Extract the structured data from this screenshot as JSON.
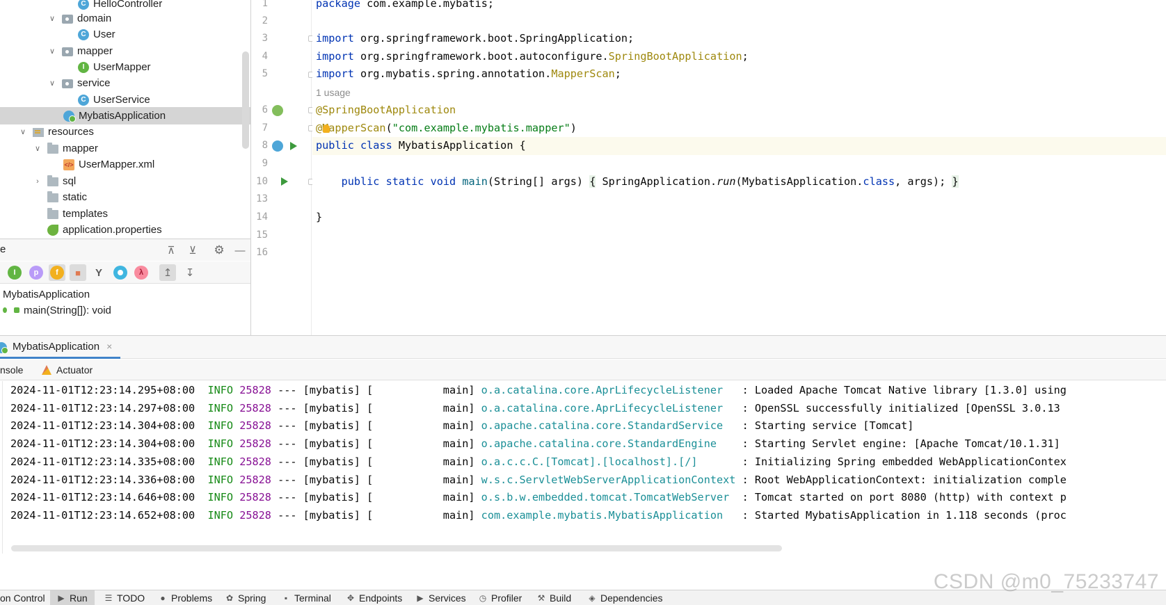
{
  "project_tree": {
    "items": [
      {
        "label": "HelloController",
        "icon": "class-icon"
      },
      {
        "label": "domain",
        "icon": "package-icon"
      },
      {
        "label": "User",
        "icon": "class-icon"
      },
      {
        "label": "mapper",
        "icon": "package-icon"
      },
      {
        "label": "UserMapper",
        "icon": "interface-icon"
      },
      {
        "label": "service",
        "icon": "package-icon"
      },
      {
        "label": "UserService",
        "icon": "class-icon"
      },
      {
        "label": "MybatisApplication",
        "icon": "spring-boot-app-icon",
        "selected": true
      },
      {
        "label": "resources",
        "icon": "resources-folder-icon"
      },
      {
        "label": "mapper",
        "icon": "folder-icon"
      },
      {
        "label": "UserMapper.xml",
        "icon": "xml-file-icon"
      },
      {
        "label": "sql",
        "icon": "folder-icon"
      },
      {
        "label": "static",
        "icon": "folder-icon"
      },
      {
        "label": "templates",
        "icon": "folder-icon"
      },
      {
        "label": "application.properties",
        "icon": "properties-file-icon"
      }
    ]
  },
  "structure": {
    "title_fragment": "e",
    "filter_icons": [
      "inherited-icon",
      "properties-p-icon",
      "fields-f-icon",
      "non-public-lock-icon",
      "hierarchy-icon",
      "anonymous-icon",
      "lambda-icon",
      "autoscroll-to-source-icon",
      "autoscroll-from-source-icon"
    ],
    "filter_letters": {
      "p": "p",
      "f": "f",
      "lambda": "λ",
      "inherited": "I"
    },
    "class_name": "MybatisApplication",
    "method": "main(String[]): void"
  },
  "editor": {
    "line_numbers": [
      "1",
      "2",
      "3",
      "4",
      "5",
      "6",
      "7",
      "8",
      "9",
      "10",
      "13",
      "14",
      "15",
      "16"
    ],
    "usage_hint": "1 usage",
    "lines": {
      "l1_kw": "package",
      "l1_rest": " com.example.mybatis;",
      "l3_kw": "import",
      "l3_rest": " org.springframework.boot.SpringApplication;",
      "l4_kw": "import",
      "l4_pkg": " org.springframework.boot.autoconfigure.",
      "l4_ann": "SpringBootApplication",
      "l4_end": ";",
      "l5_kw": "import",
      "l5_pkg": " org.mybatis.spring.annotation.",
      "l5_ann": "MapperScan",
      "l5_end": ";",
      "l6_ann": "@SpringBootApplication",
      "l7_ann": "@MapperScan",
      "l7_open": "(",
      "l7_str": "\"com.example.mybatis.mapper\"",
      "l7_close": ")",
      "l8_kw": "public class",
      "l8_rest": " MybatisApplication {",
      "l10_indent": "    ",
      "l10_kw": "public static void",
      "l10_sp": " ",
      "l10_fn": "main",
      "l10_args": "(String[] args) ",
      "l10_ob": "{",
      "l10_call": " SpringApplication.",
      "l10_run": "run",
      "l10_cls": "(MybatisApplication.",
      "l10_classkw": "class",
      "l10_tail": ", args); ",
      "l10_cb": "}",
      "l14": "}"
    }
  },
  "run_panel": {
    "tab_label": "MybatisApplication",
    "close_glyph": "×",
    "console_tab": "nsole",
    "actuator_tab": "Actuator",
    "logs": [
      {
        "ts": "2024-11-01T12:23:14.295+08:00",
        "lvl": "INFO",
        "pid": "25828",
        "sep": " --- [mybatis] [           main] ",
        "logger": "o.a.catalina.core.AprLifecycleListener  ",
        "msg": " : Loaded Apache Tomcat Native library [1.3.0] using"
      },
      {
        "ts": "2024-11-01T12:23:14.297+08:00",
        "lvl": "INFO",
        "pid": "25828",
        "sep": " --- [mybatis] [           main] ",
        "logger": "o.a.catalina.core.AprLifecycleListener  ",
        "msg": " : OpenSSL successfully initialized [OpenSSL 3.0.13"
      },
      {
        "ts": "2024-11-01T12:23:14.304+08:00",
        "lvl": "INFO",
        "pid": "25828",
        "sep": " --- [mybatis] [           main] ",
        "logger": "o.apache.catalina.core.StandardService  ",
        "msg": " : Starting service [Tomcat]"
      },
      {
        "ts": "2024-11-01T12:23:14.304+08:00",
        "lvl": "INFO",
        "pid": "25828",
        "sep": " --- [mybatis] [           main] ",
        "logger": "o.apache.catalina.core.StandardEngine   ",
        "msg": " : Starting Servlet engine: [Apache Tomcat/10.1.31]"
      },
      {
        "ts": "2024-11-01T12:23:14.335+08:00",
        "lvl": "INFO",
        "pid": "25828",
        "sep": " --- [mybatis] [           main] ",
        "logger": "o.a.c.c.C.[Tomcat].[localhost].[/]      ",
        "msg": " : Initializing Spring embedded WebApplicationContex"
      },
      {
        "ts": "2024-11-01T12:23:14.336+08:00",
        "lvl": "INFO",
        "pid": "25828",
        "sep": " --- [mybatis] [           main] ",
        "logger": "w.s.c.ServletWebServerApplicationContext",
        "msg": " : Root WebApplicationContext: initialization comple"
      },
      {
        "ts": "2024-11-01T12:23:14.646+08:00",
        "lvl": "INFO",
        "pid": "25828",
        "sep": " --- [mybatis] [           main] ",
        "logger": "o.s.b.w.embedded.tomcat.TomcatWebServer ",
        "msg": " : Tomcat started on port 8080 (http) with context p"
      },
      {
        "ts": "2024-11-01T12:23:14.652+08:00",
        "lvl": "INFO",
        "pid": "25828",
        "sep": " --- [mybatis] [           main] ",
        "logger": "com.example.mybatis.MybatisApplication  ",
        "msg": " : Started MybatisApplication in 1.118 seconds (proc"
      }
    ]
  },
  "bottom_bar": {
    "items": [
      {
        "label": "on Control",
        "icon": ""
      },
      {
        "label": "Run",
        "icon": "run-icon",
        "active": true
      },
      {
        "label": "TODO",
        "icon": "todo-icon"
      },
      {
        "label": "Problems",
        "icon": "problems-icon"
      },
      {
        "label": "Spring",
        "icon": "spring-icon"
      },
      {
        "label": "Terminal",
        "icon": "terminal-icon"
      },
      {
        "label": "Endpoints",
        "icon": "endpoints-icon"
      },
      {
        "label": "Services",
        "icon": "services-icon"
      },
      {
        "label": "Profiler",
        "icon": "profiler-icon"
      },
      {
        "label": "Build",
        "icon": "build-icon"
      },
      {
        "label": "Dependencies",
        "icon": "dependencies-icon"
      }
    ]
  },
  "watermark": "CSDN @m0_75233747"
}
